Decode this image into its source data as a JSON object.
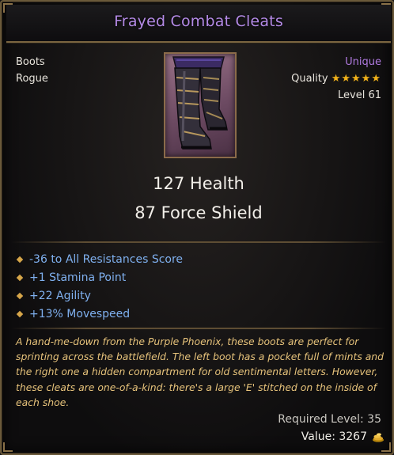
{
  "item": {
    "name": "Frayed Combat Cleats",
    "type": "Boots",
    "class": "Rogue",
    "rarity": "Unique",
    "quality_label": "Quality",
    "quality_stars": "★★★★★",
    "quality_value": 5,
    "level": "Level 61",
    "primary_stats": [
      "127 Health",
      "87 Force Shield"
    ],
    "affixes": [
      "-36 to All Resistances Score",
      "+1 Stamina Point",
      "+22 Agility",
      "+13% Movespeed"
    ],
    "lore": "A hand-me-down from the Purple Phoenix, these boots are perfect for sprinting across the battlefield. The left boot has a pocket full of mints and the right one a hidden compartment for old sentimental letters. However, these cleats are one-of-a-kind: there's a large 'E' stitched on the inside of each shoe.",
    "required_level": "Required Level: 35",
    "value": "Value: 3267",
    "currency_icon": "gold-coin-pile-icon"
  },
  "colors": {
    "title": "#b48ae6",
    "rarity": "#b07ae0",
    "affix": "#7fb0ef",
    "lore": "#e7c37b",
    "stars": "#f2b21a",
    "border": "#7a6540"
  }
}
